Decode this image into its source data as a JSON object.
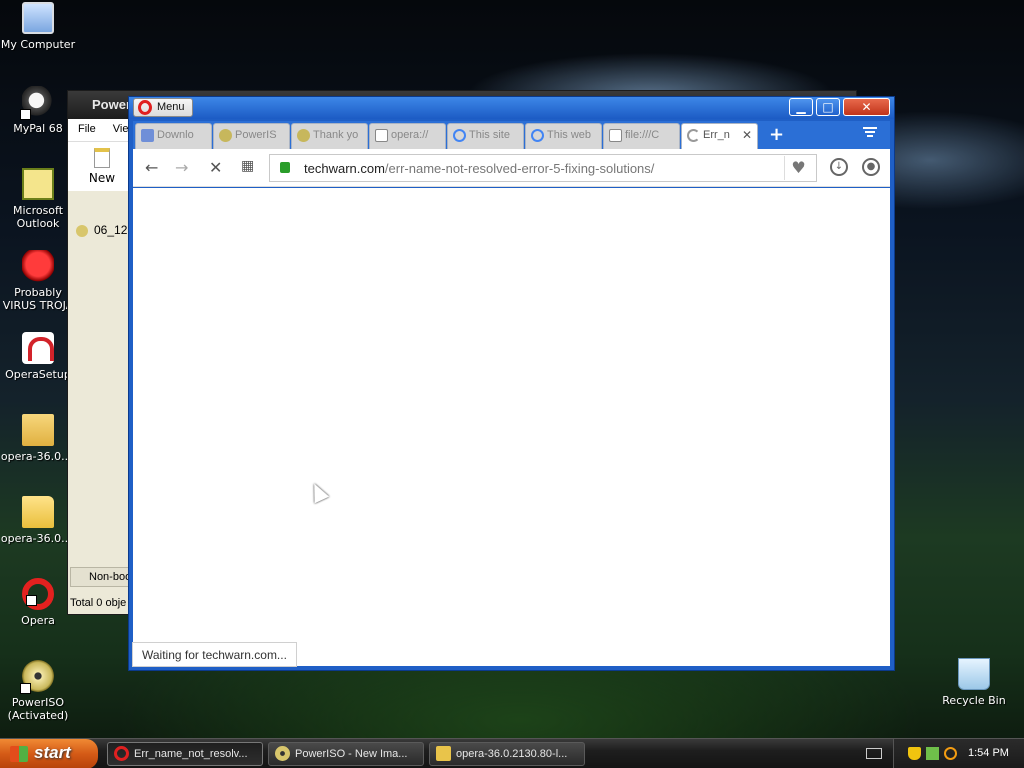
{
  "desktop": {
    "icons": [
      {
        "label": "My Computer"
      },
      {
        "label": "MyPal 68"
      },
      {
        "label": "Microsoft Outlook"
      },
      {
        "label": "Probably VIRUS TROJA"
      },
      {
        "label": "OperaSetup"
      },
      {
        "label": "opera-36.0...."
      },
      {
        "label": "opera-36.0...."
      },
      {
        "label": "Opera"
      },
      {
        "label": "PowerISO (Activated)"
      },
      {
        "label": "Recycle Bin"
      }
    ]
  },
  "poweriso": {
    "title": "Power",
    "menu": [
      "File",
      "View"
    ],
    "new_label": "New",
    "file_item": "06_12",
    "status1": "Non-boo",
    "status2": "Total 0 obje"
  },
  "opera": {
    "menu_label": "Menu",
    "tabs": [
      {
        "label": "Downlo",
        "icon": "opera-icon",
        "color": "#6f8fd8"
      },
      {
        "label": "PowerIS",
        "icon": "poweriso-icon",
        "color": "#c7b75c"
      },
      {
        "label": "Thank yo",
        "icon": "poweriso-icon",
        "color": "#c7b75c"
      },
      {
        "label": "opera://",
        "icon": "page-icon",
        "color": "#888888"
      },
      {
        "label": "This site",
        "icon": "google-icon",
        "color": "#4285f4"
      },
      {
        "label": "This web",
        "icon": "google-icon",
        "color": "#4285f4"
      },
      {
        "label": "file:///C",
        "icon": "page-icon",
        "color": "#888888"
      },
      {
        "label": "Err_n",
        "icon": "loading-icon",
        "color": "#999999"
      }
    ],
    "url_host": "techwarn.com",
    "url_path": "/err-name-not-resolved-error-5-fixing-solutions/",
    "status_text": "Waiting for techwarn.com..."
  },
  "taskbar": {
    "start_label": "start",
    "tasks": [
      {
        "label": "Err_name_not_resolv...",
        "icon": "opera-icon"
      },
      {
        "label": "PowerISO - New Ima...",
        "icon": "poweriso-icon"
      },
      {
        "label": "opera-36.0.2130.80-l...",
        "icon": "folder-icon"
      }
    ],
    "clock": "1:54 PM"
  },
  "colors": {
    "opera_frame": "#1f5fc6",
    "close_button": "#c1341a",
    "start_button": "#d45a16"
  }
}
